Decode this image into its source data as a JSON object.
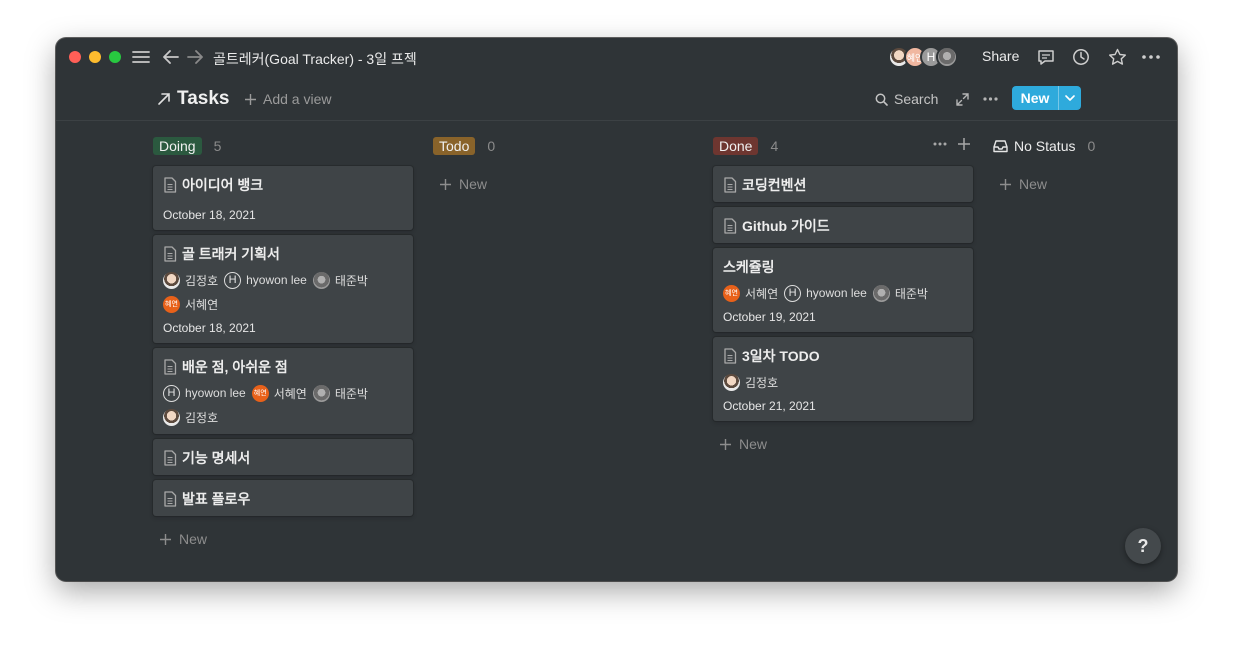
{
  "window": {
    "title": "골트레커(Goal Tracker) - 3일 프젝",
    "share_label": "Share",
    "presence": [
      {
        "name": "photo",
        "color": "#c9c9c9"
      },
      {
        "name": "서혜연",
        "initials": "혜연",
        "color": "#f0b7a0"
      },
      {
        "name": "hyowon lee",
        "initials": "H",
        "color": "#9a9a9a"
      },
      {
        "name": "태준박",
        "color": "#b0b0b0"
      }
    ]
  },
  "view": {
    "title": "Tasks",
    "add_view_label": "Add a view",
    "search_label": "Search",
    "new_label": "New"
  },
  "board": {
    "add_label": "New",
    "columns": [
      {
        "name": "Doing",
        "count": "5",
        "color": "#2b593f",
        "cards": [
          {
            "title": "아이디어 뱅크",
            "people": [],
            "date": "October 18, 2021"
          },
          {
            "title": "골 트래커 기획서",
            "people": [
              {
                "name": "김정호",
                "avatar": "photo"
              },
              {
                "name": "hyowon lee",
                "avatar": "H"
              },
              {
                "name": "태준박",
                "avatar": "grey"
              },
              {
                "name": "서혜연",
                "avatar": "orange",
                "initials": "혜연"
              }
            ],
            "date": "October 18, 2021"
          },
          {
            "title": "배운 점, 아쉬운 점",
            "people": [
              {
                "name": "hyowon lee",
                "avatar": "H"
              },
              {
                "name": "서혜연",
                "avatar": "orange",
                "initials": "혜연"
              },
              {
                "name": "태준박",
                "avatar": "grey"
              },
              {
                "name": "김정호",
                "avatar": "photo"
              }
            ],
            "date": ""
          },
          {
            "title": "기능 명세서",
            "people": [],
            "date": ""
          },
          {
            "title": "발표 플로우",
            "people": [],
            "date": ""
          }
        ]
      },
      {
        "name": "Todo",
        "count": "0",
        "color": "#89632a",
        "cards": []
      },
      {
        "name": "Done",
        "count": "4",
        "color": "#6e3630",
        "cards": [
          {
            "title": "코딩컨벤션",
            "people": [],
            "date": "",
            "icon": true
          },
          {
            "title": "Github 가이드",
            "people": [],
            "date": "",
            "icon": true
          },
          {
            "title": "스케쥴링",
            "people": [
              {
                "name": "서혜연",
                "avatar": "orange",
                "initials": "혜연"
              },
              {
                "name": "hyowon lee",
                "avatar": "H"
              },
              {
                "name": "태준박",
                "avatar": "grey"
              }
            ],
            "date": "October 19, 2021",
            "icon": false
          },
          {
            "title": "3일차 TODO",
            "people": [
              {
                "name": "김정호",
                "avatar": "photo"
              }
            ],
            "date": "October 21, 2021",
            "icon": true
          }
        ]
      },
      {
        "name": "No Status",
        "count": "0",
        "color": "",
        "cards": []
      }
    ]
  },
  "help_label": "?"
}
